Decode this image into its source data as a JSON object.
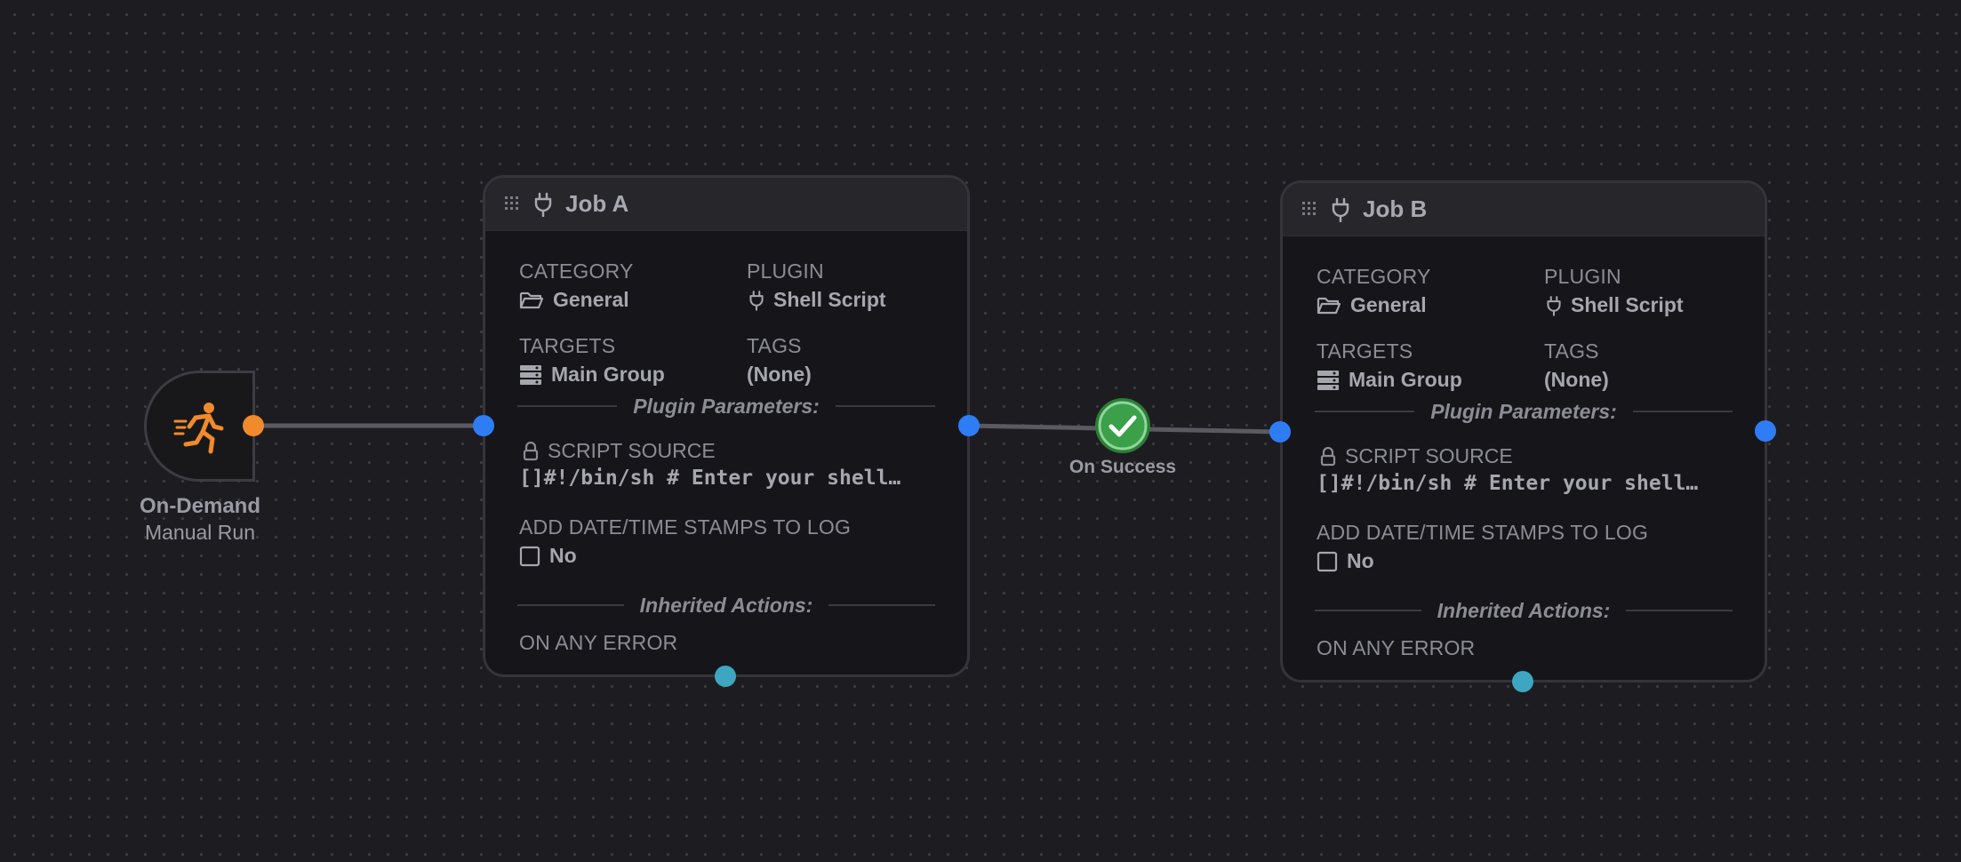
{
  "trigger": {
    "title": "On-Demand",
    "subtitle": "Manual Run",
    "icon": "running-person-icon",
    "accent": "#f08a2c"
  },
  "connection": {
    "label": "On Success",
    "icon": "check-circle-icon",
    "color": "#3aa14a"
  },
  "jobs": [
    {
      "title": "Job A",
      "category_label": "CATEGORY",
      "category_value": "General",
      "plugin_label": "PLUGIN",
      "plugin_value": "Shell Script",
      "targets_label": "TARGETS",
      "targets_value": "Main Group",
      "tags_label": "TAGS",
      "tags_value": "(None)",
      "params_heading": "Plugin Parameters:",
      "script_label": "SCRIPT SOURCE",
      "script_value": "[]#!/bin/sh # Enter your shell…",
      "timestamps_label": "ADD DATE/TIME STAMPS TO LOG",
      "timestamps_value": "No",
      "inherited_heading": "Inherited Actions:",
      "error_label": "ON ANY ERROR"
    },
    {
      "title": "Job B",
      "category_label": "CATEGORY",
      "category_value": "General",
      "plugin_label": "PLUGIN",
      "plugin_value": "Shell Script",
      "targets_label": "TARGETS",
      "targets_value": "Main Group",
      "tags_label": "TAGS",
      "tags_value": "(None)",
      "params_heading": "Plugin Parameters:",
      "script_label": "SCRIPT SOURCE",
      "script_value": "[]#!/bin/sh # Enter your shell…",
      "timestamps_label": "ADD DATE/TIME STAMPS TO LOG",
      "timestamps_value": "No",
      "inherited_heading": "Inherited Actions:",
      "error_label": "ON ANY ERROR"
    }
  ],
  "colors": {
    "port_blue": "#2f7df5",
    "port_orange": "#f08a2c",
    "port_teal": "#3ea6c0"
  }
}
